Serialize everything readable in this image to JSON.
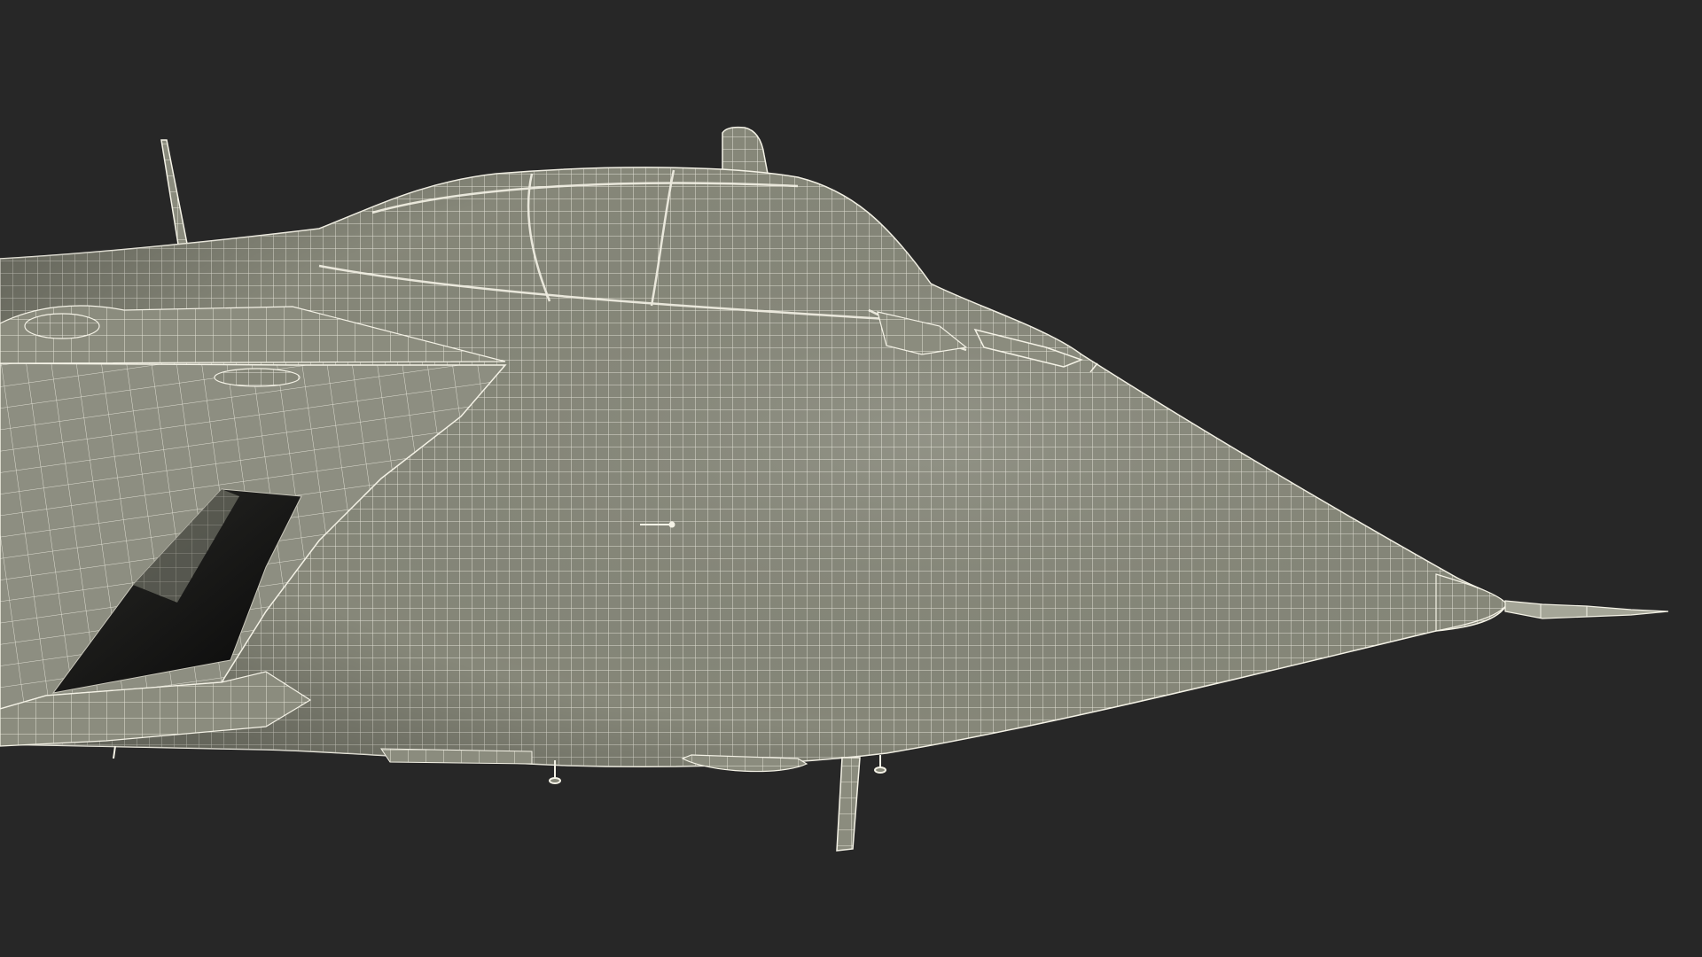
{
  "scene": {
    "subject": "jet-aircraft-nose-wireframe",
    "background_color": "#272727",
    "surface_color": "#86877a",
    "surface_light_color": "#9a9b8e",
    "wire_color": "#f4f2e6",
    "shadow_color": "#111111",
    "intake_color": "#0d0d0c"
  }
}
